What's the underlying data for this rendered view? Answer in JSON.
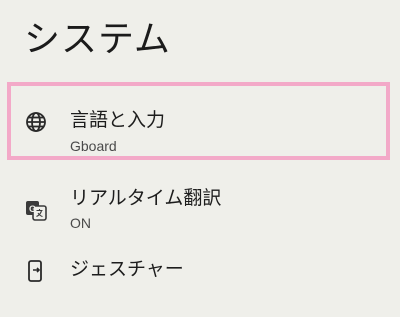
{
  "header": {
    "title": "システム"
  },
  "settings": {
    "items": [
      {
        "title": "言語と入力",
        "summary": "Gboard",
        "icon": "globe-icon",
        "highlighted": true
      },
      {
        "title": "リアルタイム翻訳",
        "summary": "ON",
        "icon": "translate-icon"
      },
      {
        "title": "ジェスチャー",
        "icon": "gesture-phone-icon"
      }
    ]
  },
  "colors": {
    "background": "#efefea",
    "highlight_border": "#f3a9c8",
    "text": "#1d1d1d",
    "secondary_text": "#4a4a4a"
  }
}
